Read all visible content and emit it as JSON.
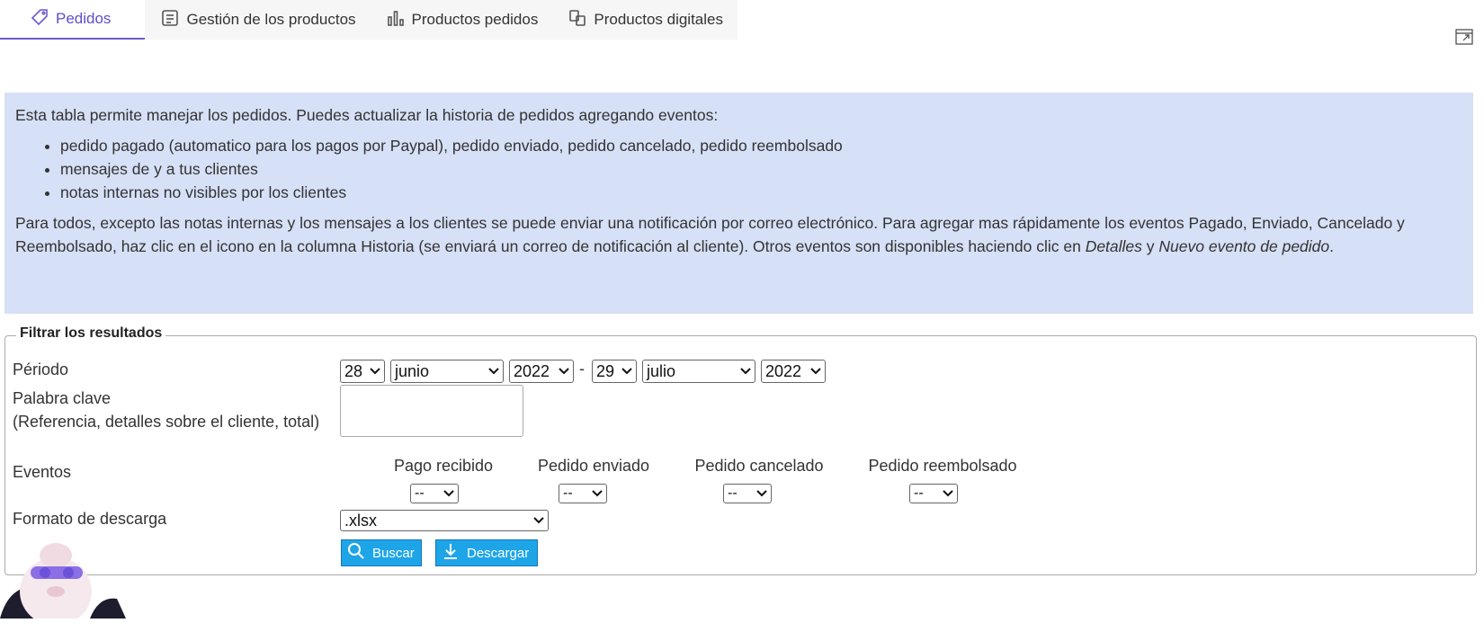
{
  "tabs": [
    {
      "label": "Pedidos",
      "icon": "tag-icon",
      "active": true
    },
    {
      "label": "Gestión de los productos",
      "icon": "product-list-icon"
    },
    {
      "label": "Productos pedidos",
      "icon": "bar-chart-icon"
    },
    {
      "label": "Productos digitales",
      "icon": "digital-products-icon"
    }
  ],
  "info": {
    "intro": "Esta tabla permite manejar los pedidos. Puedes actualizar la historia de pedidos agregando eventos:",
    "bullets": [
      "pedido pagado (automatico para los pagos por Paypal), pedido enviado, pedido cancelado, pedido reembolsado",
      "mensajes de y a tus clientes",
      "notas internas no visibles por los clientes"
    ],
    "paragraph_start": "Para todos, excepto las notas internas y los mensajes a los clientes se puede enviar una notificación por correo electrónico. Para agregar mas rápidamente los eventos Pagado, Enviado, Cancelado y Reembolsado, haz clic en el icono en la columna Historia (se enviará un correo de notificación al cliente). Otros eventos son disponibles haciendo clic en ",
    "em1": "Detalles",
    "middle": " y ",
    "em2": "Nuevo evento de pedido",
    "end": "."
  },
  "filter": {
    "legend": "Filtrar los resultados",
    "period_label": "Périodo",
    "from_day": "28",
    "from_month": "junio",
    "from_year": "2022",
    "separator": "-",
    "to_day": "29",
    "to_month": "julio",
    "to_year": "2022",
    "keyword_label": "Palabra clave",
    "keyword_hint": "(Referencia, detalles sobre el cliente, total)",
    "keyword_value": "",
    "events_label": "Eventos",
    "events": [
      {
        "label": "Pago recibido",
        "value": "--"
      },
      {
        "label": "Pedido enviado",
        "value": "--"
      },
      {
        "label": "Pedido cancelado",
        "value": "--"
      },
      {
        "label": "Pedido reembolsado",
        "value": "--"
      }
    ],
    "format_label": "Formato de descarga",
    "format_value": ".xlsx",
    "search_button": "Buscar",
    "download_button": "Descargar"
  },
  "colors": {
    "accent": "#6a5acd",
    "info_bg": "#d6e0f6",
    "button": "#1ea5e8"
  }
}
